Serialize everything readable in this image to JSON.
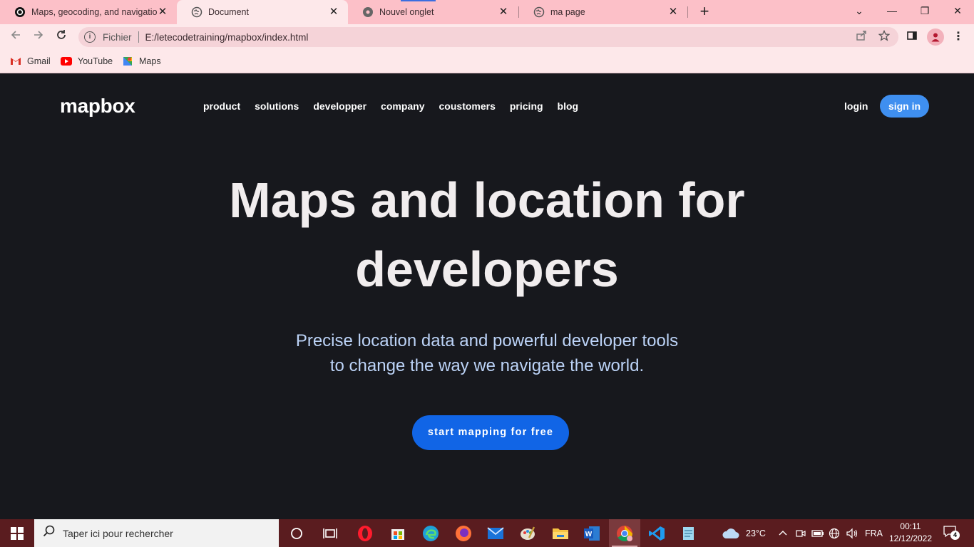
{
  "browser": {
    "tabs": [
      {
        "title": "Maps, geocoding, and navigation",
        "favicon": "mapbox-icon",
        "active": false
      },
      {
        "title": "Document",
        "favicon": "globe-icon",
        "active": true
      },
      {
        "title": "Nouvel onglet",
        "favicon": "chrome-icon",
        "active": false
      },
      {
        "title": "ma page",
        "favicon": "globe-icon",
        "active": false
      }
    ],
    "close_glyph": "✕",
    "new_tab_glyph": "+",
    "window_controls": {
      "minimize": "—",
      "restore": "❐",
      "close": "✕",
      "tab_search": "⌄"
    },
    "address": {
      "scheme_label": "Fichier",
      "url": "E:/letecodetraining/mapbox/index.html"
    },
    "bookmarks": [
      {
        "label": "Gmail",
        "icon": "gmail-icon"
      },
      {
        "label": "YouTube",
        "icon": "youtube-icon"
      },
      {
        "label": "Maps",
        "icon": "google-maps-icon"
      }
    ]
  },
  "site": {
    "logo": "mapbox",
    "nav": [
      "product",
      "solutions",
      "developper",
      "company",
      "coustomers",
      "pricing",
      "blog"
    ],
    "login": "login",
    "signin": "sign in",
    "hero_line1": "Maps and location for",
    "hero_line2": "developers",
    "sub_line1": "Precise location data and powerful developer tools",
    "sub_line2": "to change the way we navigate the world.",
    "cta": "start mapping for free"
  },
  "taskbar": {
    "search_placeholder": "Taper ici pour rechercher",
    "weather": "23°C",
    "language": "FRA",
    "time": "00:11",
    "date": "12/12/2022",
    "notification_count": "4"
  },
  "colors": {
    "page_bg": "#17181d",
    "accent_button": "#1165e6",
    "signin_button": "#3f8ff0",
    "subtitle": "#bcd3f7",
    "tabstrip": "#fcc0c8",
    "taskbar": "#5a1c1f"
  }
}
